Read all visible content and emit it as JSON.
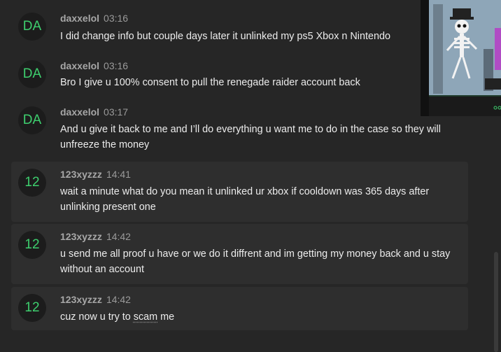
{
  "messages": [
    {
      "avatar": "DA",
      "author": "daxxelol",
      "time": "03:16",
      "text": "I did change info but couple days later it unlinked my ps5 Xbox n Nintendo",
      "highlight": false
    },
    {
      "avatar": "DA",
      "author": "daxxelol",
      "time": "03:16",
      "text": "Bro I give u 100% consent to pull the renegade raider account back",
      "highlight": false
    },
    {
      "avatar": "DA",
      "author": "daxxelol",
      "time": "03:17",
      "text": "And u give it back to me and I’ll do everything u want me to do in the case so they will unfreeze the money",
      "highlight": false
    },
    {
      "avatar": "12",
      "author": "123xyzzz",
      "time": "14:41",
      "text": "wait a minute what do you mean it unlinked ur xbox if cooldown was 365 days after unlinking present one",
      "highlight": true
    },
    {
      "avatar": "12",
      "author": "123xyzzz",
      "time": "14:42",
      "text": "u send me all proof u have or we do it diffrent and im getting my money back and u stay without an account",
      "highlight": true
    },
    {
      "avatar": "12",
      "author": "123xyzzz",
      "time": "14:42",
      "text_before": "cuz now u try to ",
      "text_link": "scam",
      "text_after": " me",
      "highlight": true
    }
  ],
  "colors": {
    "avatar_text": "#3ecf6e",
    "background": "#262626",
    "highlight": "#2e2e2e"
  }
}
